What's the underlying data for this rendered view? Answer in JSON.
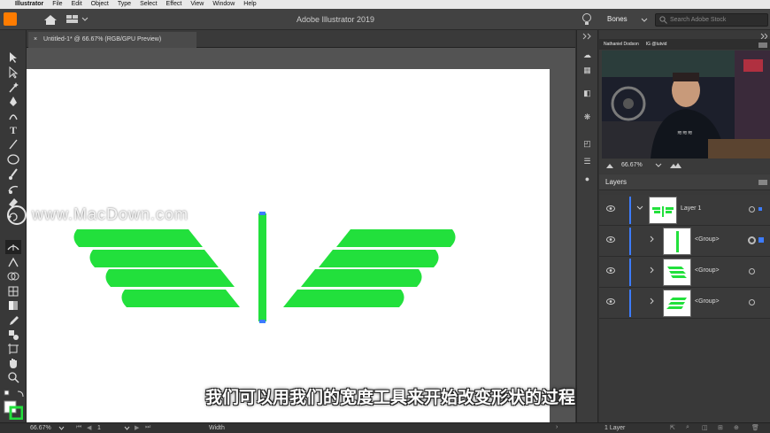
{
  "menubar": {
    "app_name": "Illustrator",
    "items": [
      "File",
      "Edit",
      "Object",
      "Type",
      "Select",
      "Effect",
      "View",
      "Window",
      "Help"
    ]
  },
  "appbar": {
    "title": "Adobe Illustrator 2019",
    "workspace": "Bones",
    "search_placeholder": "Search Adobe Stock"
  },
  "document": {
    "tab_label": "Untitled-1* @ 66.67% (RGB/GPU Preview)",
    "close_glyph": "×"
  },
  "navigator": {
    "names": [
      "Nathaniel Dodson",
      "IG @tutvid"
    ],
    "zoom": "66.67%"
  },
  "layers": {
    "title": "Layers",
    "rows": [
      {
        "name": "Layer 1"
      },
      {
        "name": "<Group>"
      },
      {
        "name": "<Group>"
      },
      {
        "name": "<Group>"
      }
    ],
    "count_label": "1 Layer"
  },
  "status": {
    "zoom": "66.67%",
    "artboard": "1",
    "tool": "Width"
  },
  "overlay": {
    "watermark": "www.MacDown.com",
    "subtitle": "我们可以用我们的宽度工具来开始改变形状的过程"
  },
  "colors": {
    "accent_green": "#22e03c",
    "selection_blue": "#3d7cff"
  },
  "icons": [
    "apple-icon",
    "home-icon",
    "workspace-icon",
    "lightbulb-icon",
    "search-icon",
    "selection-tool-icon",
    "direct-selection-icon",
    "pen-tool-icon",
    "type-tool-icon",
    "width-tool-icon",
    "eye-icon",
    "chevron-right-icon",
    "target-circle-icon",
    "hamburger-icon"
  ]
}
